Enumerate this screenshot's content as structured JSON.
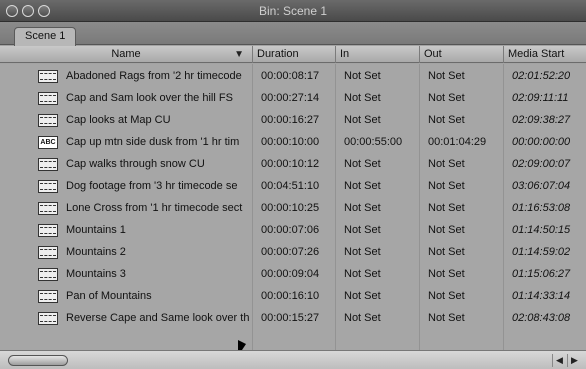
{
  "window": {
    "title": "Bin: Scene 1"
  },
  "tabs": [
    {
      "label": "Scene 1"
    }
  ],
  "columns": {
    "name": "Name",
    "duration": "Duration",
    "in": "In",
    "out": "Out",
    "media_start": "Media Start"
  },
  "rows": [
    {
      "name": "Abadoned Rags from '2 hr timecode",
      "duration": "00:00:08:17",
      "in": "Not Set",
      "out": "Not Set",
      "media_start": "02:01:52:20",
      "icon": "video-clip-icon"
    },
    {
      "name": "Cap and Sam  look over the hill FS",
      "duration": "00:00:27:14",
      "in": "Not Set",
      "out": "Not Set",
      "media_start": "02:09:11:11",
      "icon": "video-clip-icon"
    },
    {
      "name": "Cap looks at Map CU",
      "duration": "00:00:16:27",
      "in": "Not Set",
      "out": "Not Set",
      "media_start": "02:09:38:27",
      "icon": "video-clip-icon"
    },
    {
      "name": "Cap up mtn side dusk from '1 hr tim",
      "duration": "00:00:10:00",
      "in": "00:00:55:00",
      "out": "00:01:04:29",
      "media_start": "00:00:00:00",
      "icon": "text-clip-icon"
    },
    {
      "name": "Cap walks through snow CU",
      "duration": "00:00:10:12",
      "in": "Not Set",
      "out": "Not Set",
      "media_start": "02:09:00:07",
      "icon": "video-clip-icon"
    },
    {
      "name": "Dog footage from '3 hr timecode se",
      "duration": "00:04:51:10",
      "in": "Not Set",
      "out": "Not Set",
      "media_start": "03:06:07:04",
      "icon": "video-clip-icon"
    },
    {
      "name": "Lone Cross from '1 hr timecode sect",
      "duration": "00:00:10:25",
      "in": "Not Set",
      "out": "Not Set",
      "media_start": "01:16:53:08",
      "icon": "video-clip-icon"
    },
    {
      "name": "Mountains 1",
      "duration": "00:00:07:06",
      "in": "Not Set",
      "out": "Not Set",
      "media_start": "01:14:50:15",
      "icon": "video-clip-icon"
    },
    {
      "name": "Mountains 2",
      "duration": "00:00:07:26",
      "in": "Not Set",
      "out": "Not Set",
      "media_start": "01:14:59:02",
      "icon": "video-clip-icon"
    },
    {
      "name": "Mountains 3",
      "duration": "00:00:09:04",
      "in": "Not Set",
      "out": "Not Set",
      "media_start": "01:15:06:27",
      "icon": "video-clip-icon"
    },
    {
      "name": "Pan of Mountains",
      "duration": "00:00:16:10",
      "in": "Not Set",
      "out": "Not Set",
      "media_start": "01:14:33:14",
      "icon": "video-clip-icon"
    },
    {
      "name": "Reverse Cape and Same look over th",
      "duration": "00:00:15:27",
      "in": "Not Set",
      "out": "Not Set",
      "media_start": "02:08:43:08",
      "icon": "video-clip-icon"
    }
  ],
  "text_icon_label": "ABC"
}
